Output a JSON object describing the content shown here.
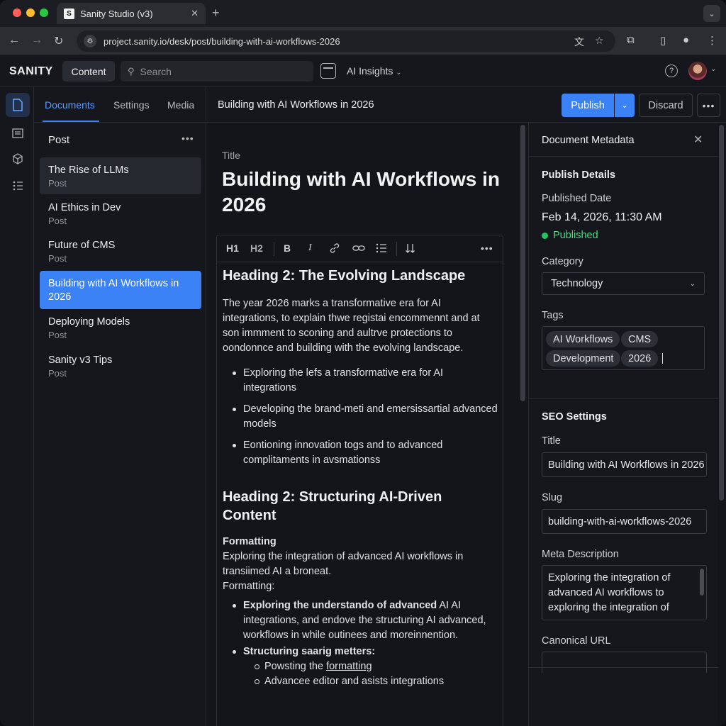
{
  "browser": {
    "tab_title": "Sanity Studio (v3)",
    "favicon_letter": "S",
    "url": "project.sanity.io/desk/post/building-with-ai-workflows-2026"
  },
  "studio": {
    "logo": "SANITY",
    "content_label": "Content",
    "search_placeholder": "Search",
    "insights_label": "AI Insights",
    "help_glyph": "?"
  },
  "list_pane": {
    "tabs": [
      "Documents",
      "Settings",
      "Media"
    ],
    "active_tab": "Documents",
    "title": "Post",
    "documents": [
      {
        "title": "The Rise of LLMs",
        "subtitle": "Post"
      },
      {
        "title": "AI Ethics in Dev",
        "subtitle": "Post"
      },
      {
        "title": "Future of CMS",
        "subtitle": "Post"
      },
      {
        "title": "Building with AI Workflows in 2026",
        "subtitle": ""
      },
      {
        "title": "Deploying Models",
        "subtitle": "Post"
      },
      {
        "title": "Sanity v3 Tips",
        "subtitle": "Post"
      }
    ]
  },
  "doc_bar": {
    "title": "Building with AI Workflows in 2026",
    "publish_label": "Publish",
    "discard_label": "Discard"
  },
  "editor": {
    "title_label": "Title",
    "title_value": "Building with AI Workflows in 2026",
    "toolbar": {
      "h1": "H1",
      "h2": "H2",
      "bold": "B",
      "italic": "I"
    },
    "heading1": "Heading 2: The Evolving Landscape",
    "para1": "The year 2026 marks a transformative era for AI integrations, to explain thwe registai encommennt and at son immment to sconing and aultrve protections to oondonnce and building with the evolving landscape.",
    "bullets1": [
      "Exploring the lefs a transformative era for AI integrations",
      "Developing the brand-meti and emersissartial advanced models",
      "Eontioning innovation togs and to advanced complitaments in avsmationss"
    ],
    "heading2": "Heading 2: Structuring AI-Driven Content",
    "formatting_bold": "Formatting",
    "para2": "Exploring the integration of advanced AI workflows in transiimed AI a broneat.",
    "formatting_plain": "Formatting:",
    "bullet2a_bold": "Exploring the understando of advanced",
    "bullet2a_rest": " AI AI integrations, and endove the structuring AI advanced,  workflows in while outinees and moreinnention.",
    "bullet2b_bold": "Structuring saarig metters:",
    "sub1_prefix": "Powsting the ",
    "sub1_link": "formatting",
    "sub2": "Advancee editor and asists integrations"
  },
  "metadata": {
    "header": "Document Metadata",
    "publish_details": "Publish Details",
    "published_date_label": "Published Date",
    "published_date": "Feb 14, 2026, 11:30 AM",
    "status": "Published",
    "category_label": "Category",
    "category": "Technology",
    "tags_label": "Tags",
    "tags": [
      "AI Workflows",
      "CMS",
      "Development",
      "2026"
    ],
    "seo_settings": "SEO Settings",
    "seo_title_label": "Title",
    "seo_title": "Building with AI Workflows in 2026",
    "slug_label": "Slug",
    "slug": "building-with-ai-workflows-2026",
    "meta_description_label": "Meta Description",
    "meta_description": "Exploring the integration of advanced AI workflows to exploring the integration of",
    "canonical_label": "Canonical URL",
    "canonical": ""
  },
  "colors": {
    "accent": "#3b82f6",
    "published_green": "#22c55e",
    "background": "#13151a"
  }
}
